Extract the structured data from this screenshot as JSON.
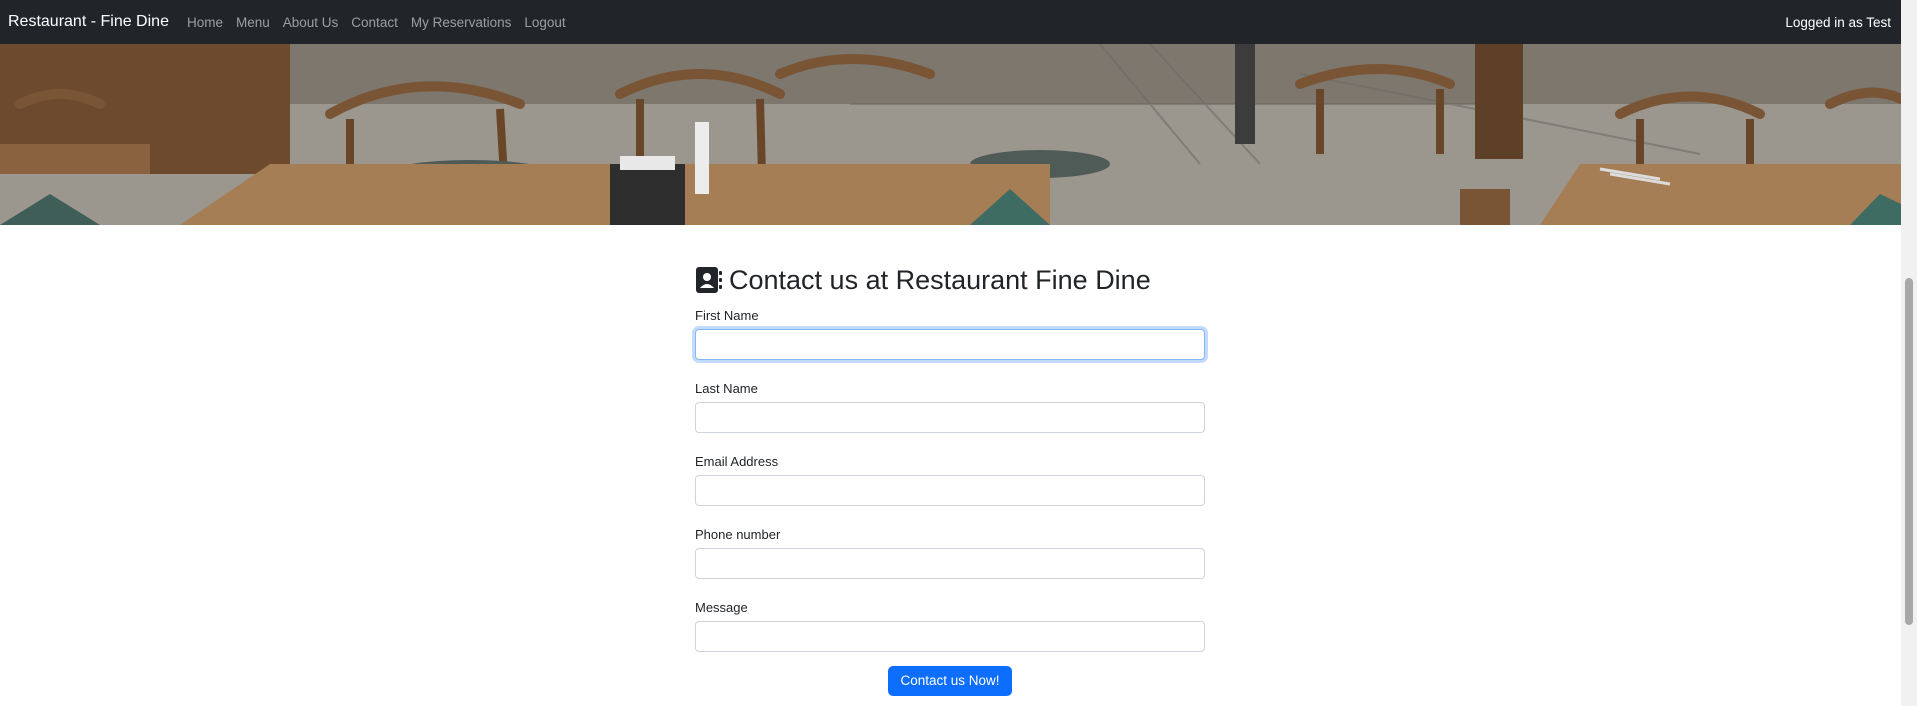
{
  "navbar": {
    "brand": "Restaurant - Fine Dine",
    "links": [
      "Home",
      "Menu",
      "About Us",
      "Contact",
      "My Reservations",
      "Logout"
    ],
    "user_status": "Logged in as Test"
  },
  "hero": {
    "image": "restaurant-interior-photo"
  },
  "contact_form": {
    "title": "Contact us at Restaurant Fine Dine",
    "title_icon": "contact-book-icon",
    "fields": [
      {
        "label": "First Name",
        "value": "",
        "focused": true
      },
      {
        "label": "Last Name",
        "value": ""
      },
      {
        "label": "Email Address",
        "value": ""
      },
      {
        "label": "Phone number",
        "value": ""
      },
      {
        "label": "Message",
        "value": ""
      }
    ],
    "submit_label": "Contact us Now!"
  },
  "colors": {
    "navbar_bg": "#212529",
    "primary": "#0d6efd",
    "focus_border": "#86b7fe"
  }
}
